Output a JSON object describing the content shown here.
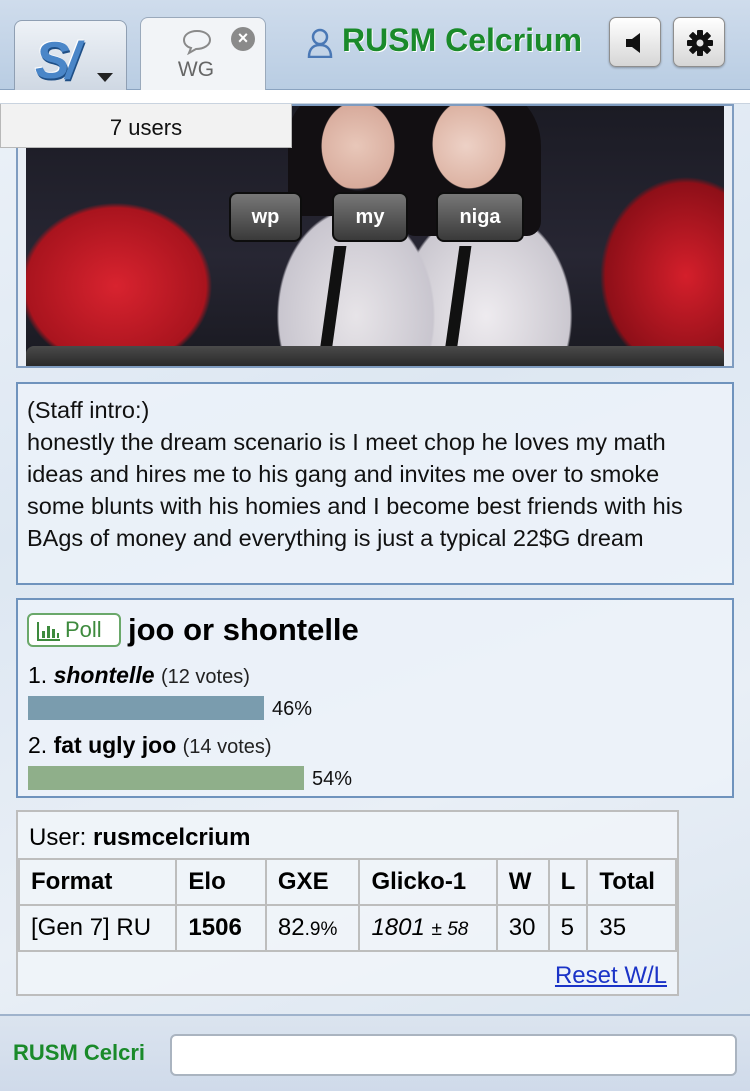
{
  "header": {
    "logo_icon": "showdown-logo-icon",
    "room_tab": {
      "label": "WG",
      "icon": "chat-bubble-icon",
      "close": "×"
    },
    "user_name": "RUSM Celcrium",
    "user_icon": "user-icon",
    "sound_icon": "speaker-icon",
    "settings_icon": "gear-icon",
    "accent_color": "#1a8a2a"
  },
  "userlist": {
    "label": "7 users"
  },
  "image_message": {
    "buttons": [
      "wp",
      "my",
      "niga"
    ]
  },
  "staff_intro": {
    "heading": "(Staff intro:)",
    "body": "honestly the dream scenario is I meet chop he loves my math ideas and hires me to his gang and invites me over to smoke some blunts with his homies and I become best friends with his BAgs of money and everything is just a typical 22$G dream"
  },
  "poll": {
    "badge": "Poll",
    "question": "joo or shontelle",
    "options": [
      {
        "num": "1.",
        "name": "shontelle",
        "votes": "(12 votes)",
        "percent_label": "46%",
        "fraction": 0.46,
        "color": "#7a9cae"
      },
      {
        "num": "2.",
        "name": "fat ugly joo",
        "votes": "(14 votes)",
        "percent_label": "54%",
        "fraction": 0.54,
        "color": "#8faf8a"
      }
    ]
  },
  "ladder": {
    "user_label": "User:",
    "user_name": "rusmcelcrium",
    "headers": [
      "Format",
      "Elo",
      "GXE",
      "Glicko-1",
      "W",
      "L",
      "Total"
    ],
    "row": {
      "format": "[Gen 7] RU",
      "elo": "1506",
      "gxe_main": "82",
      "gxe_dec": ".9%",
      "glicko_main": "1801",
      "glicko_dev": "± 58",
      "w": "30",
      "l": "5",
      "total": "35"
    },
    "reset_link": "Reset W/L"
  },
  "chat": {
    "name": "RUSM Celcri",
    "placeholder": ""
  }
}
